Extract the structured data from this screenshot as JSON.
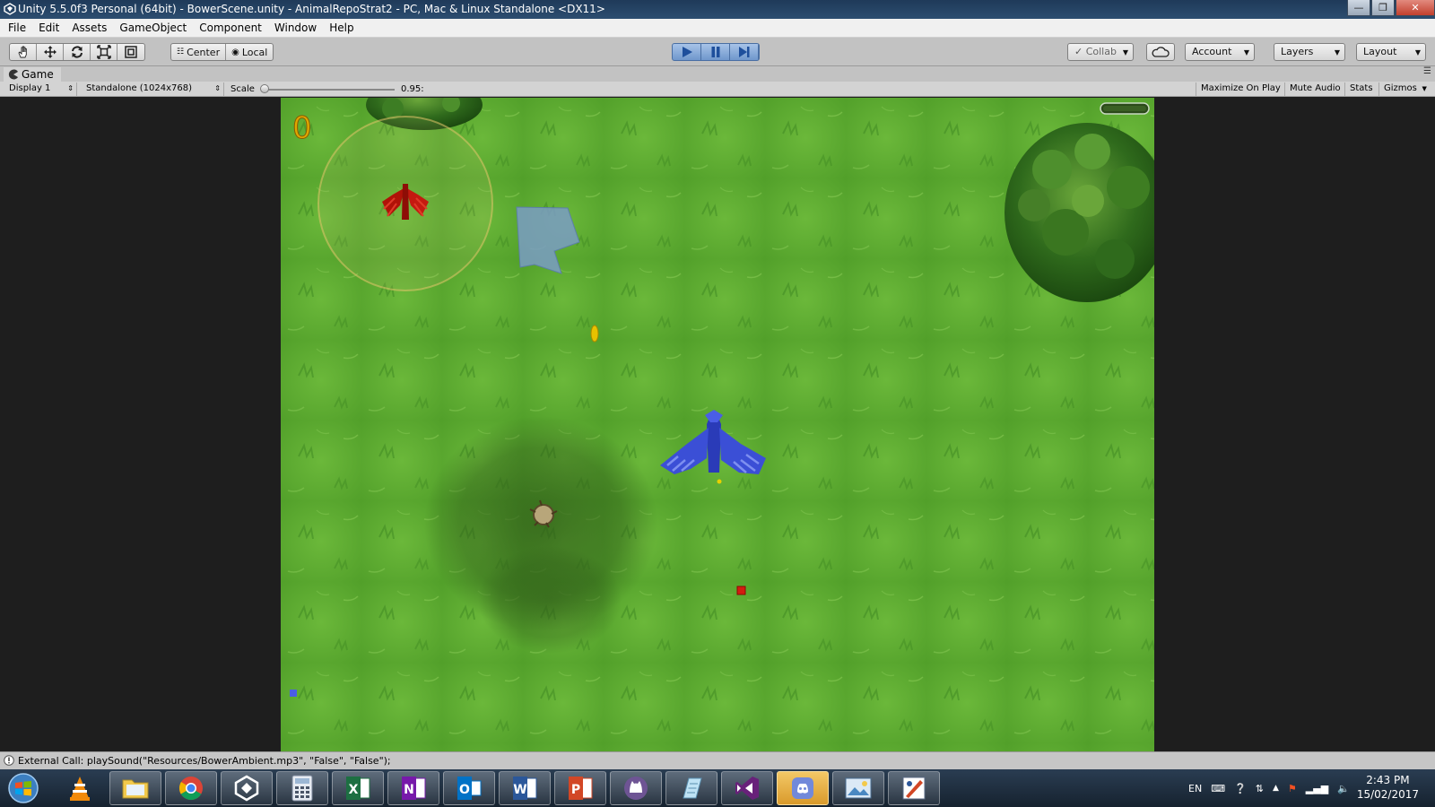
{
  "window": {
    "title": "Unity 5.5.0f3 Personal (64bit) - BowerScene.unity - AnimalRepoStrat2 - PC, Mac & Linux Standalone <DX11>"
  },
  "menubar": {
    "items": [
      "File",
      "Edit",
      "Assets",
      "GameObject",
      "Component",
      "Window",
      "Help"
    ]
  },
  "toolbar": {
    "pivot_center": "Center",
    "pivot_local": "Local",
    "collab": "Collab",
    "account": "Account",
    "layers": "Layers",
    "layout": "Layout"
  },
  "game_tab": {
    "title": "Game"
  },
  "game_view": {
    "display": "Display 1",
    "resolution": "Standalone (1024x768)",
    "scale_label": "Scale",
    "scale_value": "0.95:",
    "scale_fraction": 0.0,
    "toggles": [
      "Maximize On Play",
      "Mute Audio",
      "Stats",
      "Gizmos"
    ]
  },
  "game_scene": {
    "score_text": "0",
    "colors": {
      "grass": "#5fae32",
      "bird_player": "#3b4fd6",
      "bird_enemy": "#c41a10",
      "arrow": "#7a9cc4"
    }
  },
  "console": {
    "message": "External Call: playSound(\"Resources/BowerAmbient.mp3\", \"False\", \"False\");"
  },
  "taskbar": {
    "apps": [
      "vlc-icon",
      "file-explorer-icon",
      "chrome-icon",
      "unity-icon",
      "calculator-icon",
      "excel-icon",
      "onenote-icon",
      "outlook-icon",
      "word-icon",
      "powerpoint-icon",
      "github-desktop-icon",
      "notepad-icon",
      "visual-studio-icon",
      "discord-icon",
      "photos-icon",
      "paint-icon"
    ],
    "language": "EN",
    "time": "2:43 PM",
    "date": "15/02/2017"
  }
}
